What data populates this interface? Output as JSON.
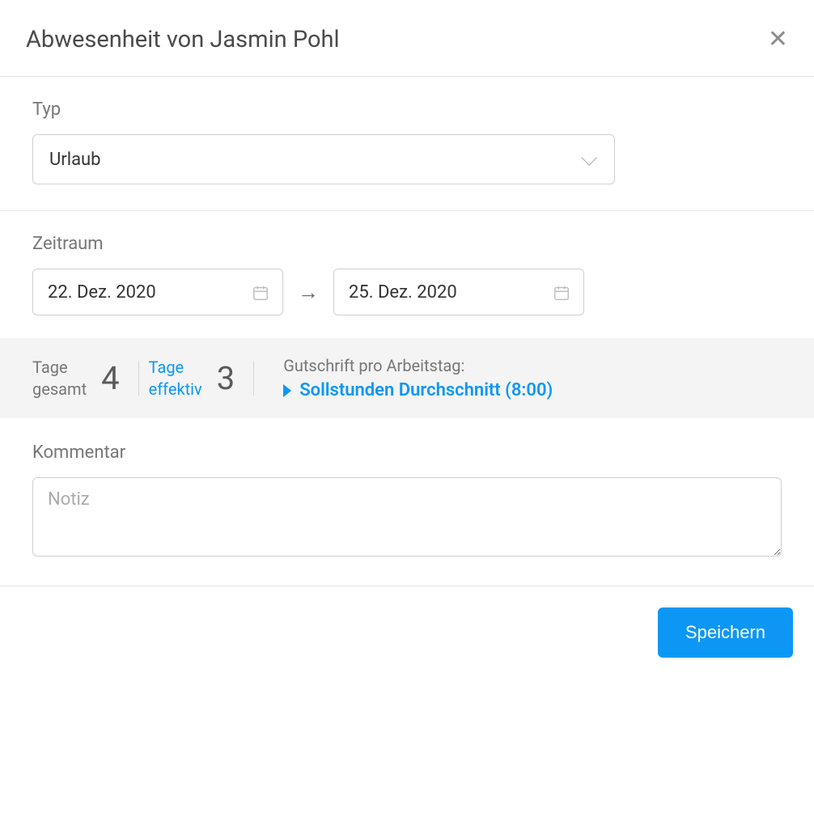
{
  "header": {
    "title": "Abwesenheit von Jasmin Pohl"
  },
  "type_section": {
    "label": "Typ",
    "selected": "Urlaub"
  },
  "period_section": {
    "label": "Zeitraum",
    "start_date": "22. Dez. 2020",
    "end_date": "25. Dez. 2020"
  },
  "summary": {
    "total_label_line1": "Tage",
    "total_label_line2": "gesamt",
    "total_value": "4",
    "effective_label_line1": "Tage",
    "effective_label_line2": "effektiv",
    "effective_value": "3",
    "credit_label": "Gutschrift pro Arbeitstag:",
    "credit_link": "Sollstunden Durchschnitt (8:00)"
  },
  "comment_section": {
    "label": "Kommentar",
    "placeholder": "Notiz",
    "value": ""
  },
  "footer": {
    "save_label": "Speichern"
  }
}
